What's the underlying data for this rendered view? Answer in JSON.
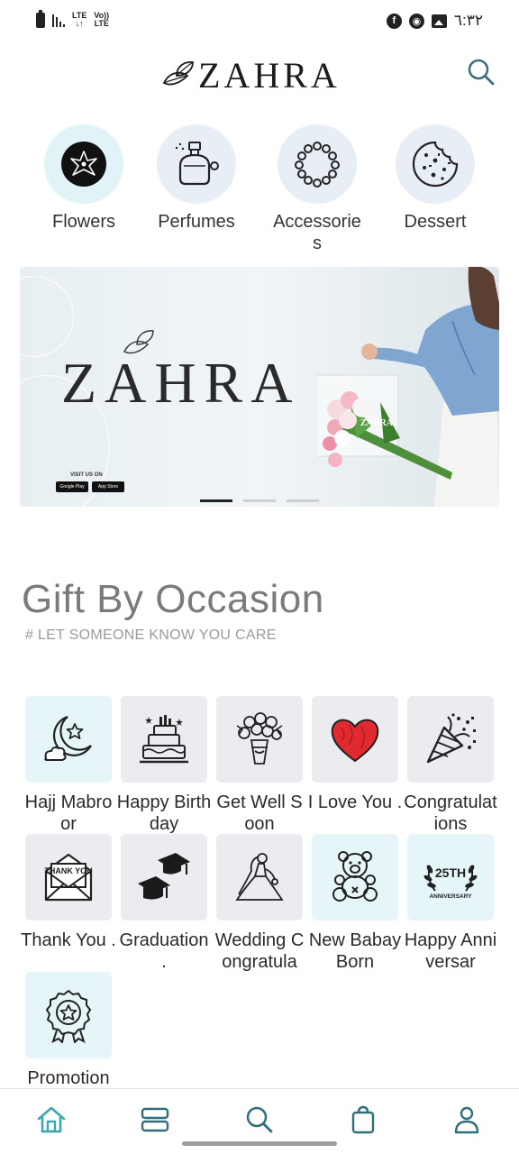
{
  "status_bar": {
    "network_1": "LTE",
    "network_2": "Vo))",
    "network_3": "LTE",
    "time": "٦:٣٢"
  },
  "header": {
    "brand": "ZAHRA",
    "search_icon": "search-icon"
  },
  "categories": [
    {
      "label": "Flowers",
      "icon": "flower-icon",
      "active": true
    },
    {
      "label": "Perfumes",
      "icon": "perfume-icon",
      "active": false
    },
    {
      "label": "Accessories",
      "icon": "necklace-icon",
      "active": false
    },
    {
      "label": "Dessert",
      "icon": "cookie-icon",
      "active": false
    }
  ],
  "banner": {
    "brand": "ZAHRA",
    "bouquet_tag": "ZAHRA",
    "visit_text": "VISIT US ON",
    "store_google": "Google Play",
    "store_apple": "App Store",
    "slides": 3,
    "active_slide": 1
  },
  "occasions": {
    "title": "Gift By Occasion",
    "subtitle": "# LET SOMEONE KNOW YOU CARE",
    "items": [
      {
        "label": "Hajj Mabroor",
        "icon": "crescent-star-icon"
      },
      {
        "label": "Happy Birthday",
        "icon": "birthday-cake-icon"
      },
      {
        "label": "Get Well Soon",
        "icon": "bouquet-icon"
      },
      {
        "label": "I Love You .",
        "icon": "heart-icon"
      },
      {
        "label": "Congratulations",
        "icon": "party-popper-icon"
      },
      {
        "label": "Thank You .",
        "icon": "thank-you-card-icon",
        "card_text": "THANK YOU"
      },
      {
        "label": "Graduation .",
        "icon": "graduation-cap-icon"
      },
      {
        "label": "Wedding Congratula",
        "icon": "bride-icon"
      },
      {
        "label": "New Babay Born",
        "icon": "teddy-bear-icon"
      },
      {
        "label": "Happy Anniversar",
        "icon": "anniversary-wreath-icon",
        "badge_text": "25TH",
        "badge_sub": "ANNIVERSARY"
      },
      {
        "label": "Promotion",
        "icon": "award-badge-icon"
      }
    ]
  },
  "bottom_nav": [
    {
      "icon": "home-icon",
      "active": true
    },
    {
      "icon": "categories-icon",
      "active": false
    },
    {
      "icon": "search-icon",
      "active": false
    },
    {
      "icon": "shopping-bag-icon",
      "active": false
    },
    {
      "icon": "profile-icon",
      "active": false
    }
  ],
  "colors": {
    "accent": "#3aa7b0",
    "tile_cyan": "#e6f6f8",
    "tile_gray": "#eaecf0"
  }
}
